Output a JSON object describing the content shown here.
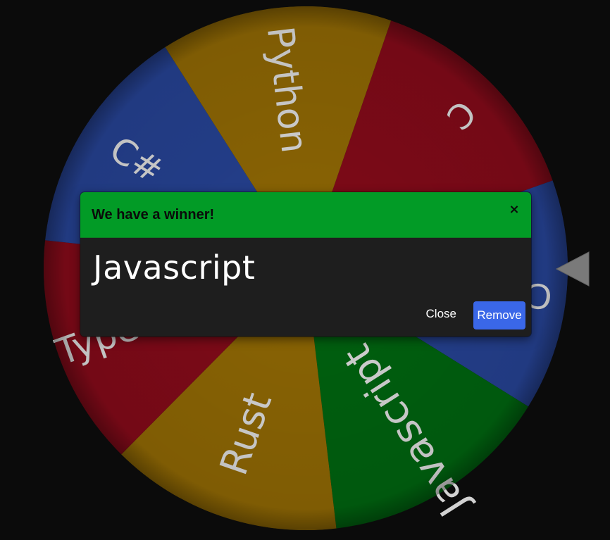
{
  "wheel": {
    "segments": [
      {
        "label": "C",
        "color": "#7e0a18"
      },
      {
        "label": "C++",
        "color": "#243f8c"
      },
      {
        "label": "Javascript",
        "color": "#00600f"
      },
      {
        "label": "Rust",
        "color": "#8a6404"
      },
      {
        "label": "Typescript",
        "color": "#7e0a18"
      },
      {
        "label": "C#",
        "color": "#243f8c"
      },
      {
        "label": "Python",
        "color": "#8a6404"
      }
    ],
    "text_color": "#d2d2d2"
  },
  "pointer": {
    "icon": "triangle-pointer-icon",
    "color": "#7a7a7a"
  },
  "modal": {
    "title": "We have a winner!",
    "close_icon": "×",
    "winner": "Javascript",
    "close_label": "Close",
    "remove_label": "Remove",
    "header_color": "#029b26",
    "remove_color": "#3a67e8"
  }
}
